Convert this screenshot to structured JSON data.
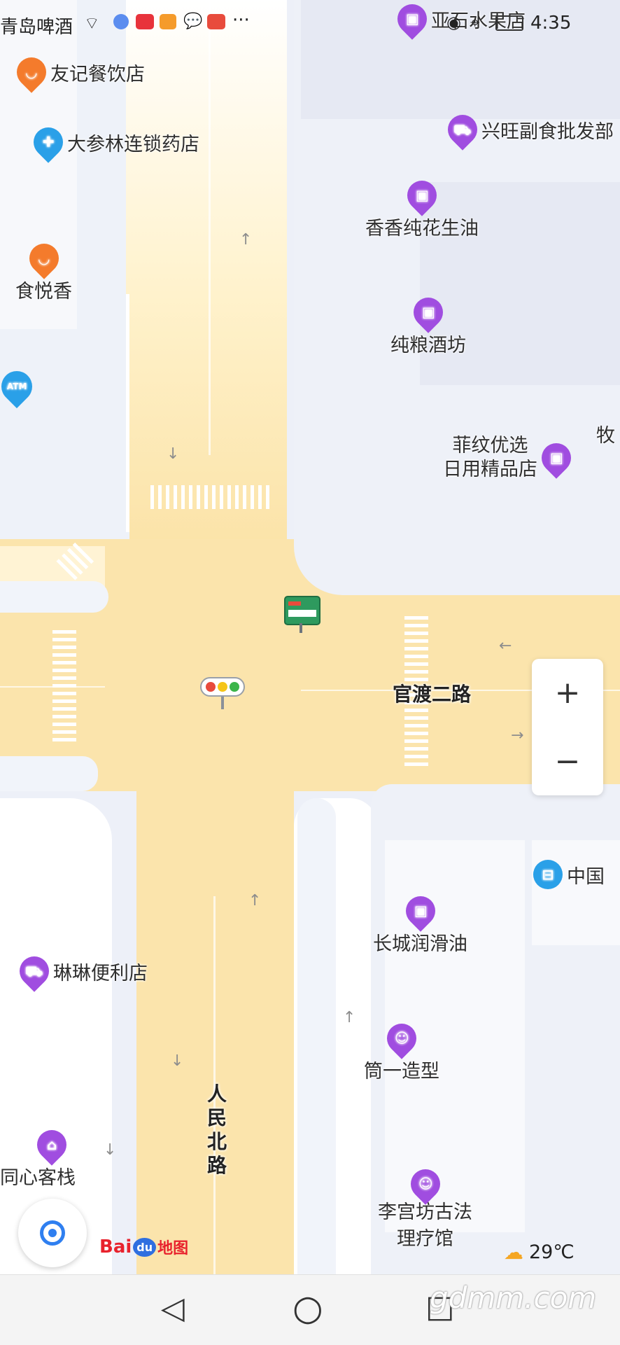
{
  "status_bar": {
    "carrier_text": "青岛啤酒",
    "time": "4:35",
    "more": "···"
  },
  "pois": {
    "yashi": "亚石水果店",
    "youji": "友记餐饮店",
    "dashenlin": "大参林连锁药店",
    "xingwang": "兴旺副食批发部",
    "xiangxiang": "香香纯花生油",
    "shiyuexiang": "食悦香",
    "chunliang": "纯粮酒坊",
    "atm": "ATM",
    "feiwen_line1": "菲纹优选",
    "feiwen_line2": "日用精品店",
    "mu": "牧",
    "zhongguo": "中国",
    "changcheng": "长城润滑油",
    "linlin": "琳琳便利店",
    "jianyi": "筒一造型",
    "tongxin": "同心客栈",
    "ligong_line1": "李宫坊古法",
    "ligong_line2": "理疗馆"
  },
  "roads": {
    "guandu": "官渡二路",
    "renmin": "人民北路"
  },
  "controls": {
    "zoom_in": "+",
    "zoom_out": "−",
    "weather": "29℃",
    "logo_bai": "Bai",
    "logo_du": "du",
    "logo_map": "地图"
  },
  "nav_bar": {
    "back": "◁",
    "home": "○",
    "recent": "□"
  },
  "watermark": "gdmm.com"
}
